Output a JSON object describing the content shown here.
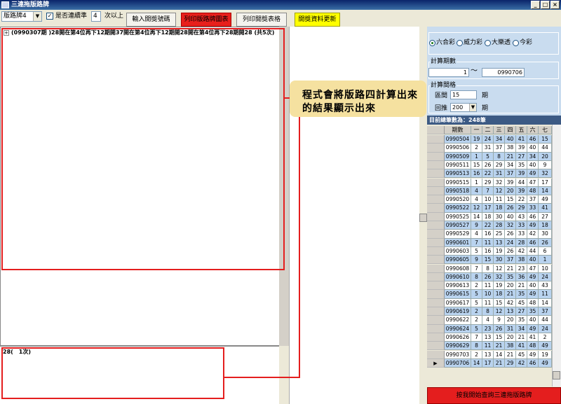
{
  "window": {
    "title": "三連拖版路牌"
  },
  "toolbar": {
    "mode_value": "版路牌4",
    "consecutive_checked": true,
    "consecutive_label": "是否連續準",
    "count_value": "4",
    "count_suffix": "次以上",
    "btn_input": "輸入開獎號碼",
    "btn_print_chart": "列印版路牌圖表",
    "btn_print_table": "列印開獎表格",
    "btn_update": "開獎資料更新"
  },
  "tree": {
    "expander": "+",
    "row": "(0990307期 )28開在第4位再下12期開37開在第4位再下12期開28開在第4位再下28期開28 (共5次)"
  },
  "bottom": {
    "line": "28(　1次)"
  },
  "annotation": {
    "line1": "程式會將版路四計算出來",
    "line2": "的結果顯示出來"
  },
  "settings": {
    "lottery_options": [
      "六合彩",
      "威力彩",
      "大樂透",
      "今彩"
    ],
    "selected_index": 0,
    "period_group": "計算期數",
    "period_from": "1",
    "period_sep": "～",
    "period_to": "0990706",
    "interval_group": "計算間格",
    "range_label": "區間",
    "range_value": "15",
    "range_unit": "期",
    "back_label": "回推",
    "back_value": "200",
    "back_unit": "期"
  },
  "grid": {
    "summary": "目前總筆數為：248筆",
    "columns": [
      "期數",
      "一",
      "二",
      "三",
      "四",
      "五",
      "六",
      "七"
    ],
    "rows": [
      [
        "0990504",
        "19",
        "24",
        "34",
        "40",
        "41",
        "46",
        "15"
      ],
      [
        "0990506",
        "2",
        "31",
        "37",
        "38",
        "39",
        "40",
        "44"
      ],
      [
        "0990509",
        "1",
        "5",
        "8",
        "21",
        "27",
        "34",
        "20"
      ],
      [
        "0990511",
        "15",
        "26",
        "29",
        "34",
        "35",
        "40",
        "9"
      ],
      [
        "0990513",
        "16",
        "22",
        "31",
        "37",
        "39",
        "49",
        "32"
      ],
      [
        "0990515",
        "1",
        "29",
        "32",
        "39",
        "44",
        "47",
        "17"
      ],
      [
        "0990518",
        "4",
        "7",
        "12",
        "20",
        "39",
        "48",
        "14"
      ],
      [
        "0990520",
        "4",
        "10",
        "11",
        "15",
        "22",
        "37",
        "49"
      ],
      [
        "0990522",
        "12",
        "17",
        "18",
        "26",
        "29",
        "33",
        "41"
      ],
      [
        "0990525",
        "14",
        "18",
        "30",
        "40",
        "43",
        "46",
        "27"
      ],
      [
        "0990527",
        "9",
        "22",
        "28",
        "32",
        "33",
        "49",
        "18"
      ],
      [
        "0990529",
        "4",
        "16",
        "25",
        "26",
        "33",
        "42",
        "30"
      ],
      [
        "0990601",
        "7",
        "11",
        "13",
        "24",
        "28",
        "46",
        "26"
      ],
      [
        "0990603",
        "5",
        "16",
        "19",
        "26",
        "42",
        "44",
        "6"
      ],
      [
        "0990605",
        "9",
        "15",
        "30",
        "37",
        "38",
        "40",
        "1"
      ],
      [
        "0990608",
        "7",
        "8",
        "12",
        "21",
        "23",
        "47",
        "10"
      ],
      [
        "0990610",
        "8",
        "26",
        "32",
        "35",
        "36",
        "49",
        "24"
      ],
      [
        "0990613",
        "2",
        "11",
        "19",
        "20",
        "21",
        "40",
        "43"
      ],
      [
        "0990615",
        "5",
        "10",
        "18",
        "21",
        "35",
        "49",
        "11"
      ],
      [
        "0990617",
        "5",
        "11",
        "15",
        "42",
        "45",
        "48",
        "14"
      ],
      [
        "0990619",
        "2",
        "8",
        "12",
        "13",
        "27",
        "35",
        "37"
      ],
      [
        "0990622",
        "2",
        "4",
        "9",
        "20",
        "35",
        "40",
        "44"
      ],
      [
        "0990624",
        "5",
        "23",
        "26",
        "31",
        "34",
        "49",
        "24"
      ],
      [
        "0990626",
        "7",
        "13",
        "15",
        "20",
        "21",
        "41",
        "2"
      ],
      [
        "0990629",
        "8",
        "11",
        "21",
        "38",
        "41",
        "48",
        "49"
      ],
      [
        "0990703",
        "2",
        "13",
        "14",
        "21",
        "45",
        "49",
        "19"
      ],
      [
        "0990706",
        "14",
        "17",
        "21",
        "29",
        "42",
        "46",
        "49"
      ]
    ],
    "current_row_marker": "▶"
  },
  "bottom_button": "按我開始查詢三連拖版路牌"
}
